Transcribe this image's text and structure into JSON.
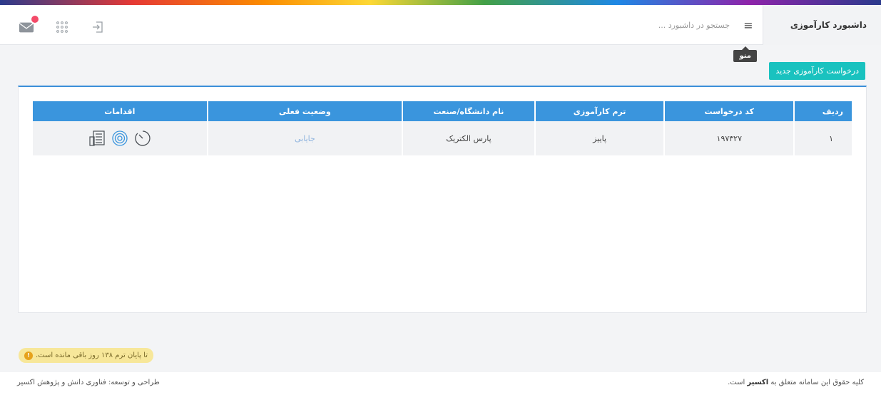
{
  "topbar": {
    "brand": "داشبورد کارآموزی",
    "menu_icon": "hamburger-icon",
    "search_placeholder": "جستجو در داشبورد ...",
    "tooltip": "منو",
    "icons": [
      "logout-icon",
      "apps-grid-icon",
      "mail-icon"
    ]
  },
  "actions_bar": {
    "new_request_label": "درخواست کارآموزی جدید"
  },
  "table": {
    "headers": [
      "ردیف",
      "کد درخواست",
      "ترم کارآموزی",
      "نام دانشگاه/صنعت",
      "وضعیت فعلی",
      "اقدامات"
    ],
    "rows": [
      {
        "index": "۱",
        "code": "۱۹۷۳۲۷",
        "term": "پاییز",
        "org": "پارس الکتریک",
        "status": "جایابی",
        "actions": [
          "timer-icon",
          "target-icon",
          "document-icon"
        ]
      }
    ]
  },
  "notice": {
    "text": "تا پایان ترم ۱۳۸ روز باقی مانده است."
  },
  "footer": {
    "rights_prefix": "کلیه حقوق این سامانه متعلق به",
    "rights_brand": "اکسیر",
    "rights_suffix": "است.",
    "credit": "طراحی و توسعه: فناوری دانش و پژوهش اکسیر"
  },
  "colors": {
    "primary": "#3a95dd",
    "button": "#19c2bf",
    "badge": "#f44b69",
    "notice_bg": "#f7e79a"
  }
}
